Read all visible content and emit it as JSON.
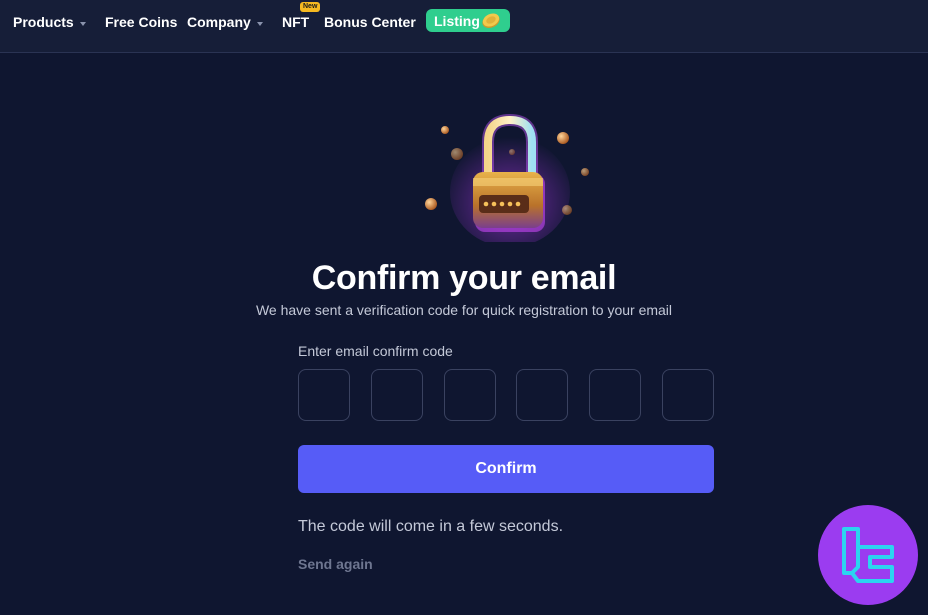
{
  "nav": {
    "products": "Products",
    "free_coins": "Free Coins",
    "company": "Company",
    "nft": "NFT",
    "nft_badge": "New",
    "bonus_center": "Bonus Center",
    "listing": "Listing"
  },
  "main": {
    "title": "Confirm your email",
    "subtitle": "We have sent a verification code for quick registration to your email",
    "code_label": "Enter email confirm code",
    "code_digits": [
      "",
      "",
      "",
      "",
      "",
      ""
    ],
    "confirm_label": "Confirm",
    "wait_text": "The code will come in a few seconds.",
    "send_again": "Send again"
  },
  "colors": {
    "background": "#0f1630",
    "topbar": "#161e38",
    "accent": "#565cf7",
    "listing": "#2fce8e",
    "badge": "#f5b921",
    "watermark": "#9b3cf0"
  },
  "icons": {
    "hero": "padlock-icon",
    "listing": "coin-icon",
    "watermark": "brand-logo"
  }
}
